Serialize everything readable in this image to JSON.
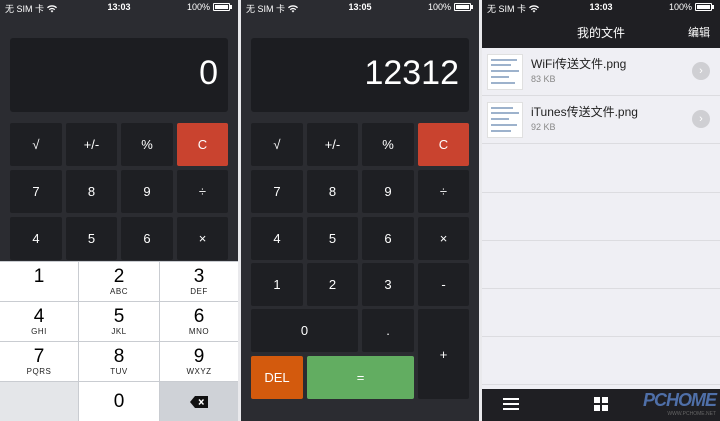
{
  "panels": [
    {
      "status": {
        "carrier": "无 SIM 卡",
        "time": "13:03",
        "battery": "100%"
      },
      "display": "0",
      "keys": [
        "√",
        "+/-",
        "%",
        "C",
        "7",
        "8",
        "9",
        "÷",
        "4",
        "5",
        "6",
        "×"
      ]
    },
    {
      "status": {
        "carrier": "无 SIM 卡",
        "time": "13:05",
        "battery": "100%"
      },
      "display": "12312",
      "keys": [
        "√",
        "+/-",
        "%",
        "C",
        "7",
        "8",
        "9",
        "÷",
        "4",
        "5",
        "6",
        "×",
        "1",
        "2",
        "3",
        "-",
        "0",
        ".",
        "+",
        "DEL",
        "="
      ]
    },
    {
      "status": {
        "carrier": "无 SIM 卡",
        "time": "13:03",
        "battery": "100%"
      },
      "title": "我的文件",
      "edit": "编辑",
      "files": [
        {
          "name": "WiFi传送文件.png",
          "size": "83 KB"
        },
        {
          "name": "iTunes传送文件.png",
          "size": "92 KB"
        }
      ]
    }
  ],
  "numpad": [
    {
      "digit": "1",
      "letters": ""
    },
    {
      "digit": "2",
      "letters": "ABC"
    },
    {
      "digit": "3",
      "letters": "DEF"
    },
    {
      "digit": "4",
      "letters": "GHI"
    },
    {
      "digit": "5",
      "letters": "JKL"
    },
    {
      "digit": "6",
      "letters": "MNO"
    },
    {
      "digit": "7",
      "letters": "PQRS"
    },
    {
      "digit": "8",
      "letters": "TUV"
    },
    {
      "digit": "9",
      "letters": "WXYZ"
    },
    {
      "digit": "0",
      "letters": ""
    }
  ],
  "watermark": {
    "brand": "PCHOME",
    "url": "WWW.PCHOME.NET"
  },
  "icons": {
    "backspace": "backspace-icon",
    "list": "list-icon",
    "grid": "grid-icon",
    "chevron": "chevron-right-icon",
    "wifi": "wifi-icon"
  },
  "colors": {
    "clear": "#c9432f",
    "del": "#d35a0d",
    "equals": "#62ad61",
    "bg": "#2b2c31"
  }
}
